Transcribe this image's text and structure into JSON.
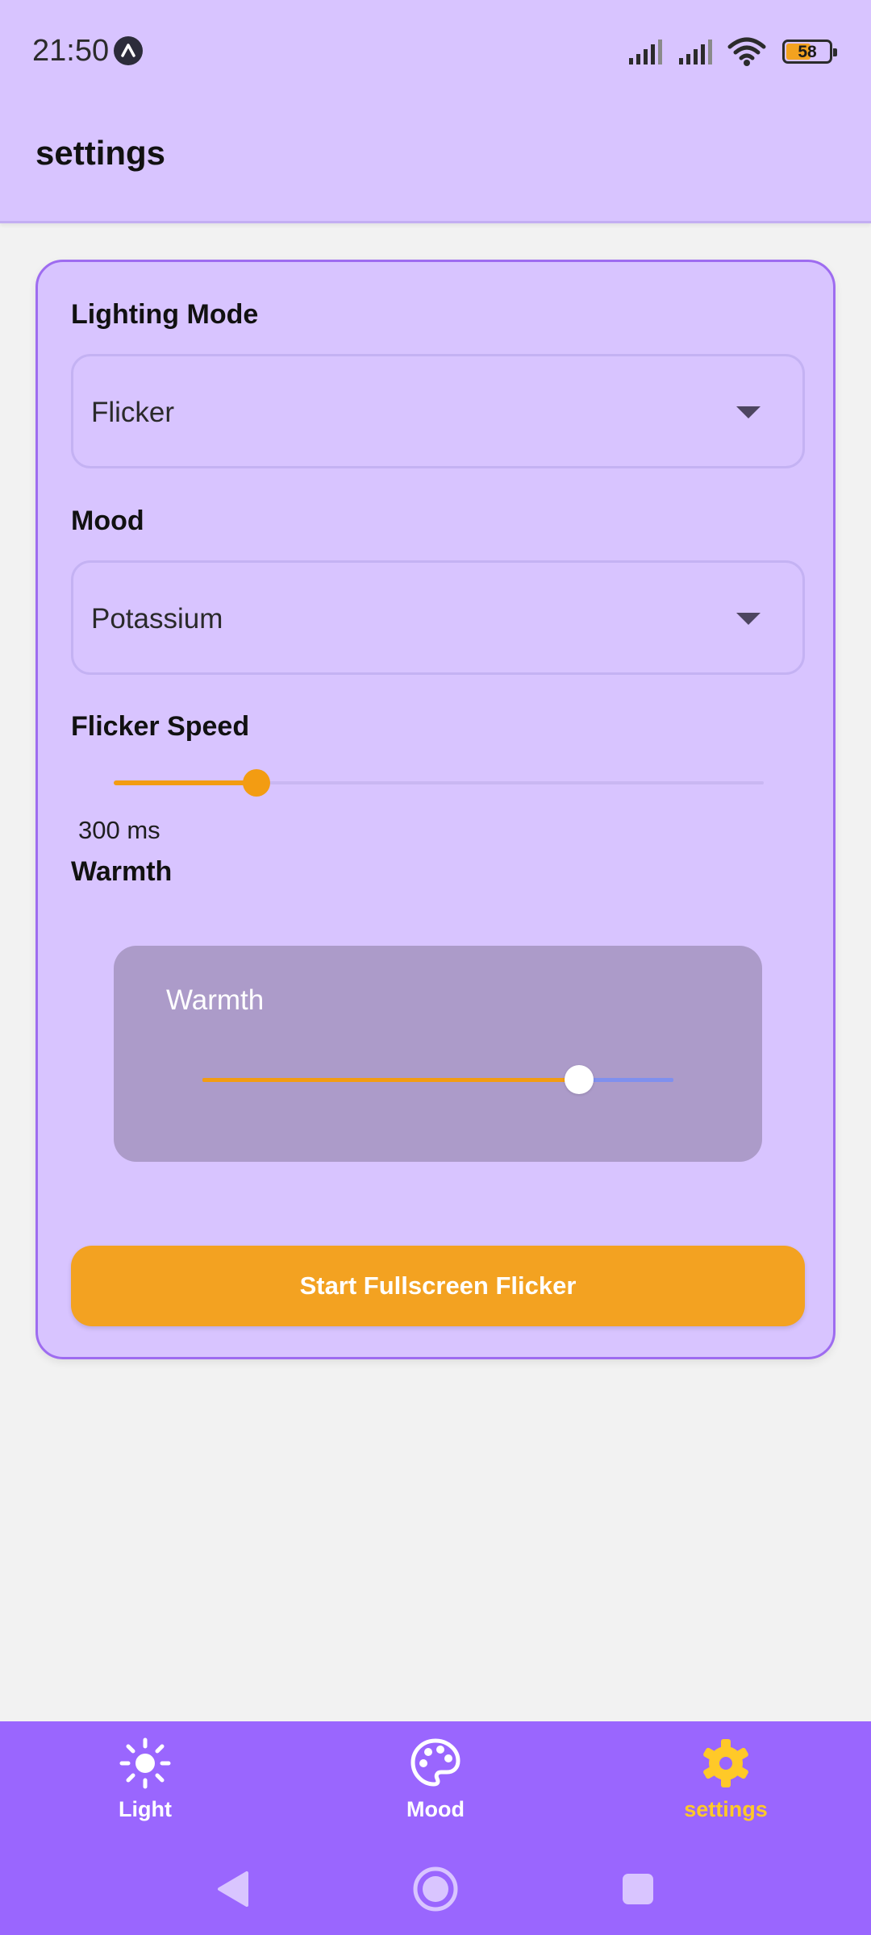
{
  "status_bar": {
    "time": "21:50",
    "battery_percent": 58,
    "battery_label": "58",
    "icons": [
      "app-notification-icon",
      "signal-icon",
      "signal-icon",
      "wifi-icon",
      "battery-icon"
    ]
  },
  "app_bar": {
    "title": "settings"
  },
  "settings": {
    "lighting_mode": {
      "label": "Lighting Mode",
      "value": "Flicker"
    },
    "mood": {
      "label": "Mood",
      "value": "Potassium"
    },
    "flicker_speed": {
      "label": "Flicker Speed",
      "value_text": "300 ms",
      "fraction": 0.22
    },
    "warmth": {
      "label": "Warmth",
      "panel_label": "Warmth",
      "fraction": 0.8
    },
    "start_button_label": "Start Fullscreen Flicker"
  },
  "bottom_nav": {
    "items": [
      {
        "label": "Light",
        "icon": "sun-icon",
        "active": false
      },
      {
        "label": "Mood",
        "icon": "palette-icon",
        "active": false
      },
      {
        "label": "settings",
        "icon": "gear-icon",
        "active": true
      }
    ]
  },
  "system_nav": {
    "icons": [
      "back-icon",
      "home-icon",
      "recents-icon"
    ]
  },
  "colors": {
    "primary": "#9a66fe",
    "surface": "#d8c4ff",
    "accent": "#f39c12",
    "active_nav": "#ffc928",
    "warmth_track": "#7f90ee"
  }
}
